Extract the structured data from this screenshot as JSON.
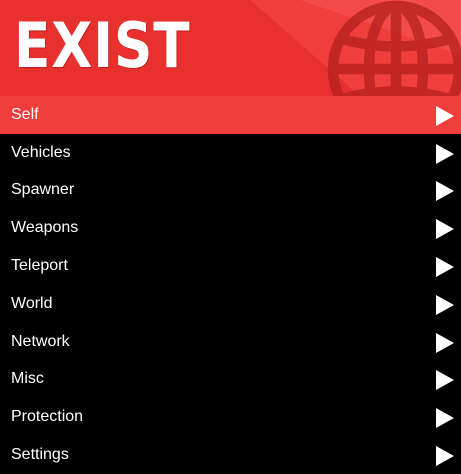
{
  "header": {
    "title": "EXIST",
    "logo_icon": "globe-icon",
    "background_color": "#e8302e"
  },
  "menu": {
    "selected_index": 0,
    "selected_color": "#f13e3c",
    "arrow_icon": "play-arrow-icon",
    "items": [
      {
        "label": "Self",
        "name": "self"
      },
      {
        "label": "Vehicles",
        "name": "vehicles"
      },
      {
        "label": "Spawner",
        "name": "spawner"
      },
      {
        "label": "Weapons",
        "name": "weapons"
      },
      {
        "label": "Teleport",
        "name": "teleport"
      },
      {
        "label": "World",
        "name": "world"
      },
      {
        "label": "Network",
        "name": "network"
      },
      {
        "label": "Misc",
        "name": "misc"
      },
      {
        "label": "Protection",
        "name": "protection"
      },
      {
        "label": "Settings",
        "name": "settings"
      }
    ]
  }
}
